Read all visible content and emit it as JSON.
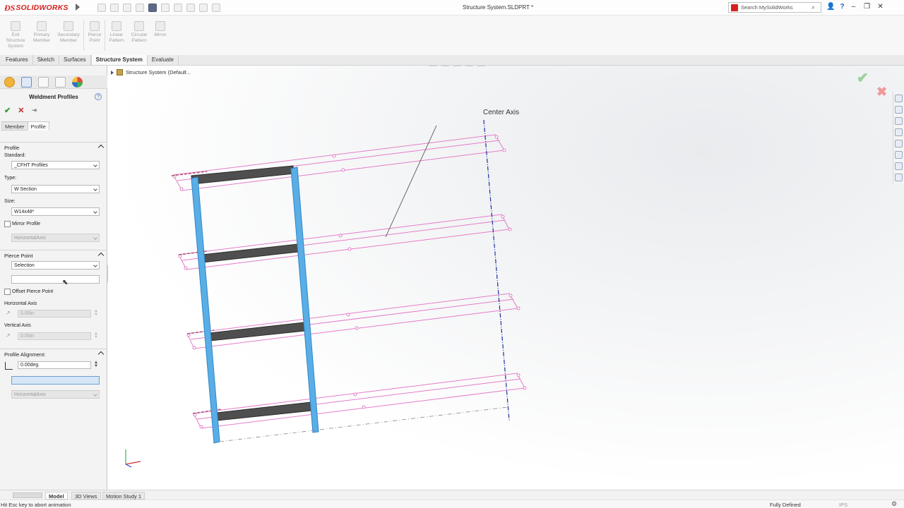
{
  "app": {
    "logo": "SOLIDWORKS",
    "window_title": "Structure System.SLDPRT *",
    "search_placeholder": "Search MySolidWorks",
    "help_label": "?"
  },
  "command_manager": {
    "buttons": [
      {
        "label": "Exit Structure System",
        "line1": "Exit",
        "line2": "Structure",
        "line3": "System"
      },
      {
        "label": "Primary Member",
        "line1": "Primary",
        "line2": "Member",
        "line3": ""
      },
      {
        "label": "Secondary Member",
        "line1": "Secondary",
        "line2": "Member",
        "line3": ""
      },
      {
        "label": "Pierce Point",
        "line1": "Pierce",
        "line2": "Point",
        "line3": ""
      },
      {
        "label": "Linear Pattern",
        "line1": "Linear",
        "line2": "Pattern",
        "line3": ""
      },
      {
        "label": "Circular Pattern",
        "line1": "Circular",
        "line2": "Pattern",
        "line3": ""
      },
      {
        "label": "Mirror",
        "line1": "Mirror",
        "line2": "",
        "line3": ""
      }
    ]
  },
  "tabs": [
    "Features",
    "Sketch",
    "Surfaces",
    "Structure System",
    "Evaluate"
  ],
  "active_tab": "Structure System",
  "property_manager": {
    "title": "Weldment Profiles",
    "subtabs": [
      "Member",
      "Profile"
    ],
    "active_subtab": "Profile",
    "profile_group": {
      "header": "Profile",
      "standard_label": "Standard:",
      "standard_value": "_CFHT Profiles",
      "type_label": "Type:",
      "type_value": "W Section",
      "size_label": "Size:",
      "size_value": "W14x48*",
      "mirror_label": "Mirror Profile",
      "mirror_checked": false,
      "mirror_axis": "HorizontalAxis"
    },
    "pierce_group": {
      "header": "Pierce Point",
      "selection_value": "Selection",
      "offset_label": "Offset Pierce Point",
      "offset_checked": false,
      "horizontal_label": "Horizontal Axis",
      "horizontal_value": "0.00in",
      "vertical_label": "Vertical Axis",
      "vertical_value": "0.00in"
    },
    "alignment_group": {
      "header": "Profile Alignment:",
      "angle_value": "0.00deg",
      "axis_value": "HorizontalAxis"
    }
  },
  "viewport": {
    "tree_root": "Structure System  (Default...",
    "annotation": "Center Axis",
    "colors": {
      "beam_blue": "#5aaee6",
      "beam_dark": "#4f4f4f",
      "sketch_pink": "#e57cc8",
      "axis_blue": "#1a2fa0"
    }
  },
  "bottom_tabs": [
    "Model",
    "3D Views",
    "Motion Study 1"
  ],
  "active_bottom_tab": "Model",
  "status": {
    "message": "Hit Esc key to abort animation",
    "state": "Fully Defined",
    "units": "IPS"
  }
}
